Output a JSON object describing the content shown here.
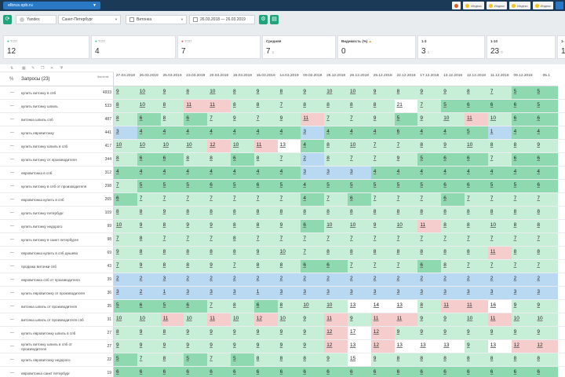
{
  "topbar": {
    "site": "elbrus.spb.ru",
    "badge1": "Индекс",
    "badge2": "Индекс",
    "badge3": "Индекс",
    "badge4": "Индекс"
  },
  "filters": {
    "engine": "Yandex",
    "region": "Санкт-Петербург",
    "group": "Витонка",
    "date_range": "26.03.2018 — 26.03.2019"
  },
  "cards": [
    {
      "label": "ТОП",
      "value": "12",
      "sub": ""
    },
    {
      "label": "ТОП",
      "value": "4",
      "sub": ""
    },
    {
      "label": "ТОП",
      "value": "7",
      "sub": ""
    },
    {
      "label": "Средняя",
      "value": "7",
      "sub": "1"
    },
    {
      "label": "Видимость (%)",
      "value": "0",
      "sub": ""
    },
    {
      "label": "1-3",
      "value": "3",
      "sub": "1"
    },
    {
      "label": "1-10",
      "value": "23",
      "sub": "0"
    },
    {
      "label": "1-",
      "value": "1",
      "sub": ""
    }
  ],
  "table": {
    "queries_header": "Запросы (23)",
    "freq_header": "Частота",
    "dates": [
      "27.03.2019",
      "26.03.2019",
      "25.03.2019",
      "23.03.2019",
      "20.03.2019",
      "18.03.2019",
      "15.03.2019",
      "14.03.2019",
      "09.02.2019",
      "26.12.2018",
      "26.12.2018",
      "25.12.2018",
      "22.12.2018",
      "17.12.2018",
      "13.12.2018",
      "12.12.2018",
      "11.12.2018",
      "09.12.2018",
      "05.1"
    ],
    "rows": [
      {
        "kw": "купить витонку в спб",
        "freq": "4933",
        "vals": [
          "9",
          "10",
          "9",
          "8",
          "10",
          "8",
          "9",
          "8",
          "9",
          "10",
          "10",
          "9",
          "8",
          "9",
          "9",
          "8",
          "7",
          "5",
          "5"
        ]
      },
      {
        "kw": "купить витонку шпиль",
        "freq": "533",
        "vals": [
          "8",
          "10",
          "8",
          "11",
          "11",
          "8",
          "8",
          "7",
          "8",
          "8",
          "8",
          "8",
          "21",
          "7",
          "5",
          "6",
          "6",
          "6",
          "5"
        ]
      },
      {
        "kw": "витонка шпиль спб",
        "freq": "487",
        "vals": [
          "8",
          "6",
          "8",
          "6",
          "7",
          "9",
          "7",
          "9",
          "11",
          "7",
          "7",
          "9",
          "5",
          "9",
          "10",
          "11",
          "10",
          "6",
          "6"
        ]
      },
      {
        "kw": "купить евровитонку",
        "freq": "441",
        "vals": [
          "3",
          "4",
          "4",
          "4",
          "4",
          "4",
          "4",
          "4",
          "3",
          "4",
          "4",
          "4",
          "6",
          "4",
          "4",
          "5",
          "1",
          "4",
          "4"
        ]
      },
      {
        "kw": "купить витонку шпиль в спб",
        "freq": "417",
        "vals": [
          "10",
          "10",
          "10",
          "10",
          "12",
          "10",
          "11",
          "13",
          "4",
          "8",
          "10",
          "7",
          "7",
          "8",
          "9",
          "10",
          "8",
          "8",
          "9"
        ]
      },
      {
        "kw": "купить витонку от производителя",
        "freq": "344",
        "vals": [
          "8",
          "6",
          "6",
          "8",
          "8",
          "6",
          "8",
          "7",
          "2",
          "8",
          "7",
          "7",
          "9",
          "5",
          "6",
          "6",
          "7",
          "6",
          "6"
        ]
      },
      {
        "kw": "евровитонка в спб",
        "freq": "312",
        "vals": [
          "4",
          "4",
          "4",
          "4",
          "4",
          "4",
          "4",
          "4",
          "3",
          "3",
          "3",
          "4",
          "4",
          "4",
          "4",
          "4",
          "4",
          "4",
          "4"
        ]
      },
      {
        "kw": "купить витонку в спб от производителя",
        "freq": "298",
        "vals": [
          "7",
          "5",
          "5",
          "5",
          "6",
          "5",
          "6",
          "5",
          "4",
          "5",
          "5",
          "5",
          "5",
          "5",
          "6",
          "6",
          "5",
          "5",
          "6"
        ]
      },
      {
        "kw": "евровитонка купить в спб",
        "freq": "265",
        "vals": [
          "6",
          "7",
          "7",
          "7",
          "7",
          "7",
          "7",
          "7",
          "4",
          "7",
          "6",
          "7",
          "7",
          "7",
          "6",
          "7",
          "7",
          "7",
          "7"
        ]
      },
      {
        "kw": "купить витонку петербург",
        "freq": "109",
        "vals": [
          "8",
          "8",
          "9",
          "8",
          "8",
          "8",
          "8",
          "8",
          "8",
          "8",
          "8",
          "8",
          "8",
          "8",
          "8",
          "8",
          "8",
          "8",
          "8"
        ]
      },
      {
        "kw": "купить витонку недорого",
        "freq": "99",
        "vals": [
          "10",
          "9",
          "8",
          "9",
          "9",
          "8",
          "8",
          "9",
          "6",
          "10",
          "10",
          "9",
          "10",
          "11",
          "8",
          "8",
          "10",
          "8",
          "8"
        ]
      },
      {
        "kw": "купить витонку в санкт петербурге",
        "freq": "98",
        "vals": [
          "7",
          "8",
          "7",
          "7",
          "7",
          "8",
          "7",
          "7",
          "7",
          "7",
          "7",
          "7",
          "7",
          "7",
          "7",
          "7",
          "7",
          "7",
          "7"
        ]
      },
      {
        "kw": "евровитонка купить в спб дешево",
        "freq": "69",
        "vals": [
          "9",
          "8",
          "8",
          "8",
          "8",
          "8",
          "9",
          "10",
          "7",
          "8",
          "8",
          "8",
          "8",
          "8",
          "8",
          "8",
          "11",
          "8",
          "8"
        ]
      },
      {
        "kw": "продажа витонки спб",
        "freq": "43",
        "vals": [
          "7",
          "9",
          "8",
          "8",
          "9",
          "7",
          "8",
          "8",
          "6",
          "6",
          "7",
          "7",
          "7",
          "6",
          "8",
          "7",
          "7",
          "7",
          "7"
        ]
      },
      {
        "kw": "евровитонка спб от производителя",
        "freq": "39",
        "vals": [
          "2",
          "2",
          "3",
          "2",
          "2",
          "2",
          "2",
          "2",
          "2",
          "2",
          "2",
          "2",
          "2",
          "2",
          "2",
          "2",
          "2",
          "2",
          "2"
        ]
      },
      {
        "kw": "купить евровитонку от производителя",
        "freq": "36",
        "vals": [
          "3",
          "2",
          "1",
          "3",
          "3",
          "3",
          "1",
          "3",
          "3",
          "3",
          "3",
          "3",
          "3",
          "3",
          "3",
          "3",
          "3",
          "3",
          "3"
        ]
      },
      {
        "kw": "витонка шпиль от производителя",
        "freq": "35",
        "vals": [
          "5",
          "6",
          "5",
          "6",
          "7",
          "8",
          "6",
          "8",
          "10",
          "10",
          "13",
          "14",
          "13",
          "8",
          "11",
          "11",
          "16",
          "9",
          "9"
        ]
      },
      {
        "kw": "витонка шпиль от производителя спб",
        "freq": "31",
        "vals": [
          "10",
          "10",
          "11",
          "10",
          "11",
          "10",
          "12",
          "10",
          "9",
          "11",
          "9",
          "11",
          "11",
          "9",
          "9",
          "10",
          "11",
          "10",
          "10"
        ]
      },
      {
        "kw": "купить евровитонку шпиль в спб",
        "freq": "27",
        "vals": [
          "8",
          "9",
          "8",
          "9",
          "9",
          "9",
          "9",
          "9",
          "9",
          "12",
          "17",
          "12",
          "9",
          "9",
          "9",
          "9",
          "9",
          "9",
          "9"
        ]
      },
      {
        "kw": "купить витонку шпиль в спб от производителя",
        "freq": "27",
        "vals": [
          "9",
          "9",
          "9",
          "9",
          "9",
          "9",
          "9",
          "9",
          "9",
          "12",
          "13",
          "12",
          "13",
          "13",
          "13",
          "9",
          "13",
          "12",
          "12"
        ]
      },
      {
        "kw": "купить евровитонку недорого",
        "freq": "22",
        "vals": [
          "5",
          "7",
          "8",
          "5",
          "7",
          "5",
          "8",
          "8",
          "8",
          "9",
          "15",
          "9",
          "8",
          "8",
          "8",
          "8",
          "8",
          "8",
          "8"
        ]
      },
      {
        "kw": "евровитонка санкт петербург",
        "freq": "19",
        "vals": [
          "6",
          "6",
          "6",
          "6",
          "6",
          "6",
          "6",
          "6",
          "6",
          "6",
          "6",
          "6",
          "6",
          "6",
          "6",
          "6",
          "6",
          "6",
          "6"
        ]
      },
      {
        "kw": "купить евровитонку в спб недорого",
        "freq": "9",
        "vals": [
          "7",
          "7",
          "7",
          "7",
          "7",
          "7",
          "7",
          "7",
          "7",
          "7",
          "7",
          "7",
          "7",
          "7",
          "7",
          "12",
          "7",
          "7",
          "7"
        ]
      }
    ]
  },
  "colors": {
    "topbar": "#1b3a57",
    "accent": "#2a78c4",
    "green_btn": "#22a37a",
    "good": "#8fd9b0",
    "mid": "#c7eed7",
    "bad": "#f6cdcd",
    "blue": "#b9d8f2",
    "white": "#ffffff"
  }
}
